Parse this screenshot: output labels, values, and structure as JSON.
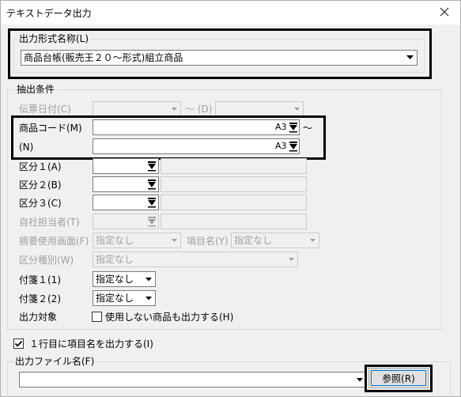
{
  "window": {
    "title": "テキストデータ出力"
  },
  "format": {
    "group_label": "出力形式名称(L)",
    "value": "商品台帳(販売王２０～形式)組立商品"
  },
  "conditions": {
    "group_label": "抽出条件",
    "slip_date_label": "伝票日付(C)",
    "slip_date_sep": "～ (D)",
    "product_code_label": "商品コード(M)",
    "product_code_from_tag": "A3",
    "product_code_tilde": "～",
    "product_code_to_label": "(N)",
    "product_code_to_tag": "A3",
    "cat1_label": "区分１(A)",
    "cat2_label": "区分２(B)",
    "cat3_label": "区分３(C)",
    "staff_label": "自社担当者(T)",
    "summary_label": "摘要使用画面(F)",
    "summary_value": "指定なし",
    "item_name_label": "項目名(Y)",
    "item_name_value": "指定なし",
    "cat_type_label": "区分種別(W)",
    "cat_type_value": "指定なし",
    "tag1_label": "付箋１(1)",
    "tag1_value": "指定なし",
    "tag2_label": "付箋２(2)",
    "tag2_value": "指定なし",
    "target_label": "出力対象",
    "unused_checkbox_label": "使用しない商品も出力する(H)"
  },
  "options": {
    "header_checkbox_label": "１行目に項目名を出力する(I)",
    "header_checked": true
  },
  "output_file": {
    "group_label": "出力ファイル名(F)",
    "value": "",
    "browse_label": "参照(R)"
  },
  "colors": {
    "highlight_border": "#000000",
    "focus_blue": "#0078d7"
  }
}
